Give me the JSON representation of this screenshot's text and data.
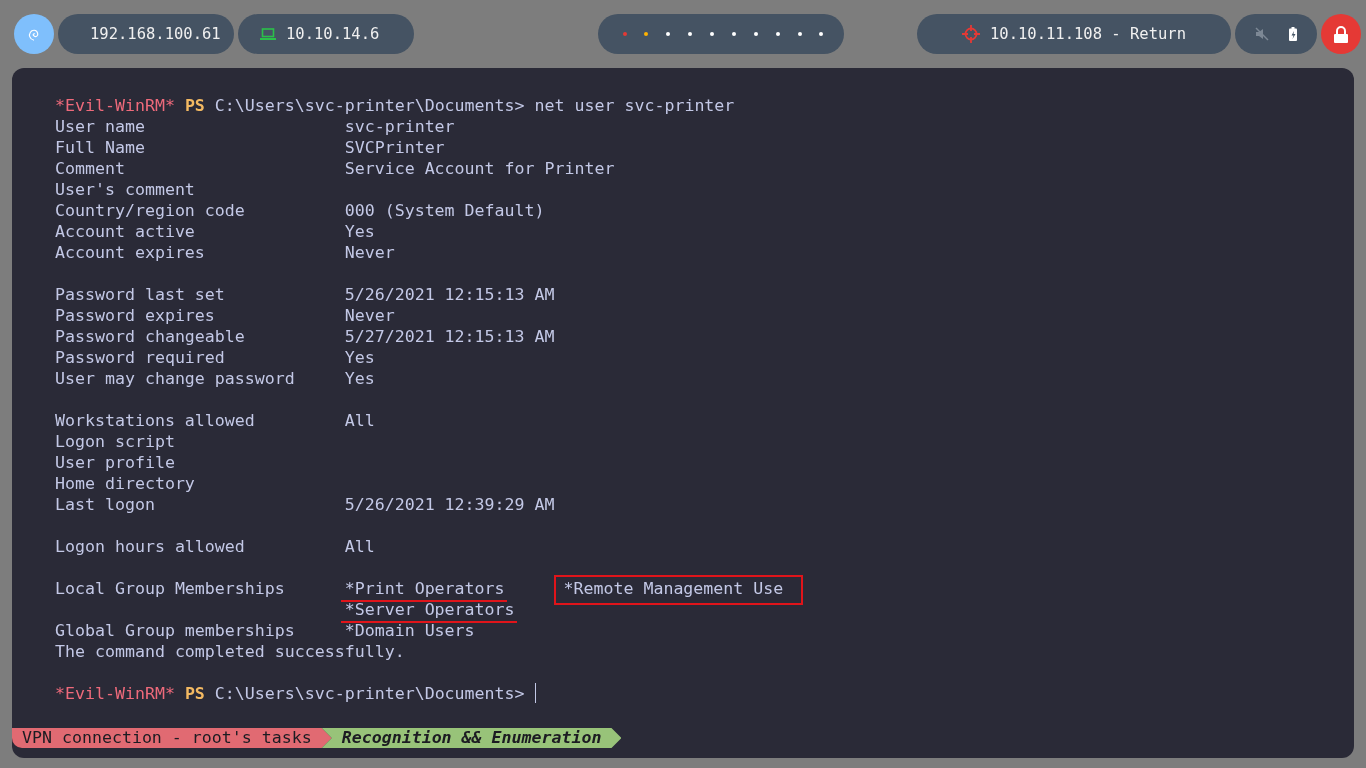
{
  "top_bar": {
    "left_pills": [
      {
        "kind": "ethernet",
        "text": "192.168.100.61"
      },
      {
        "kind": "laptop",
        "text": "10.10.14.6"
      }
    ],
    "workspaces": [
      {
        "color": "#e53935"
      },
      {
        "color": "#ffb300"
      },
      {
        "color": "#ffffff"
      },
      {
        "color": "#ffffff"
      },
      {
        "color": "#ffffff"
      },
      {
        "color": "#ffffff"
      },
      {
        "color": "#ffffff"
      },
      {
        "color": "#ffffff"
      },
      {
        "color": "#ffffff"
      },
      {
        "color": "#ffffff"
      }
    ],
    "target": {
      "text": "10.10.11.108 - Return"
    }
  },
  "terminal": {
    "lines": [
      {
        "kind": "prompt",
        "tag": "*Evil-WinRM*",
        "shell": "PS",
        "path": "C:\\Users\\svc-printer\\Documents>",
        "command": "net user svc-printer",
        "cursor": false
      },
      {
        "kind": "field",
        "label": "User name",
        "values": [
          {
            "text": "svc-printer"
          }
        ]
      },
      {
        "kind": "field",
        "label": "Full Name",
        "values": [
          {
            "text": "SVCPrinter"
          }
        ]
      },
      {
        "kind": "field",
        "label": "Comment",
        "values": [
          {
            "text": "Service Account for Printer"
          }
        ]
      },
      {
        "kind": "field",
        "label": "User's comment"
      },
      {
        "kind": "field",
        "label": "Country/region code",
        "values": [
          {
            "text": "000 (System Default)"
          }
        ]
      },
      {
        "kind": "field",
        "label": "Account active",
        "values": [
          {
            "text": "Yes"
          }
        ]
      },
      {
        "kind": "field",
        "label": "Account expires",
        "values": [
          {
            "text": "Never"
          }
        ]
      },
      {
        "kind": "blank"
      },
      {
        "kind": "field",
        "label": "Password last set",
        "values": [
          {
            "text": "5/26/2021 12:15:13 AM"
          }
        ]
      },
      {
        "kind": "field",
        "label": "Password expires",
        "values": [
          {
            "text": "Never"
          }
        ]
      },
      {
        "kind": "field",
        "label": "Password changeable",
        "values": [
          {
            "text": "5/27/2021 12:15:13 AM"
          }
        ]
      },
      {
        "kind": "field",
        "label": "Password required",
        "values": [
          {
            "text": "Yes"
          }
        ]
      },
      {
        "kind": "field",
        "label": "User may change password",
        "values": [
          {
            "text": "Yes"
          }
        ]
      },
      {
        "kind": "blank"
      },
      {
        "kind": "field",
        "label": "Workstations allowed",
        "values": [
          {
            "text": "All"
          }
        ]
      },
      {
        "kind": "field",
        "label": "Logon script"
      },
      {
        "kind": "field",
        "label": "User profile"
      },
      {
        "kind": "field",
        "label": "Home directory"
      },
      {
        "kind": "field",
        "label": "Last logon",
        "values": [
          {
            "text": "5/26/2021 12:39:29 AM"
          }
        ]
      },
      {
        "kind": "blank"
      },
      {
        "kind": "field",
        "label": "Logon hours allowed",
        "values": [
          {
            "text": "All"
          }
        ]
      },
      {
        "kind": "blank"
      },
      {
        "kind": "field",
        "label": "Local Group Memberships",
        "values": [
          {
            "text": "*Print Operators",
            "underlined": true,
            "boxed": false
          },
          {
            "text": "*Remote Management Use",
            "underlined": false,
            "boxed": true
          }
        ]
      },
      {
        "kind": "field",
        "values": [
          {
            "text": "*Server Operators",
            "underlined": true,
            "boxed": false
          }
        ]
      },
      {
        "kind": "field",
        "label": "Global Group memberships",
        "values": [
          {
            "text": "*Domain Users"
          }
        ]
      },
      {
        "kind": "text",
        "text": "The command completed successfully."
      },
      {
        "kind": "blank"
      },
      {
        "kind": "prompt",
        "tag": "*Evil-WinRM*",
        "shell": "PS",
        "path": "C:\\Users\\svc-printer\\Documents>",
        "cursor": true
      }
    ],
    "status_bar": [
      {
        "kind": "session",
        "text": "VPN connection - root's tasks"
      },
      {
        "kind": "window",
        "text": "Recognition && Enumeration"
      }
    ]
  }
}
